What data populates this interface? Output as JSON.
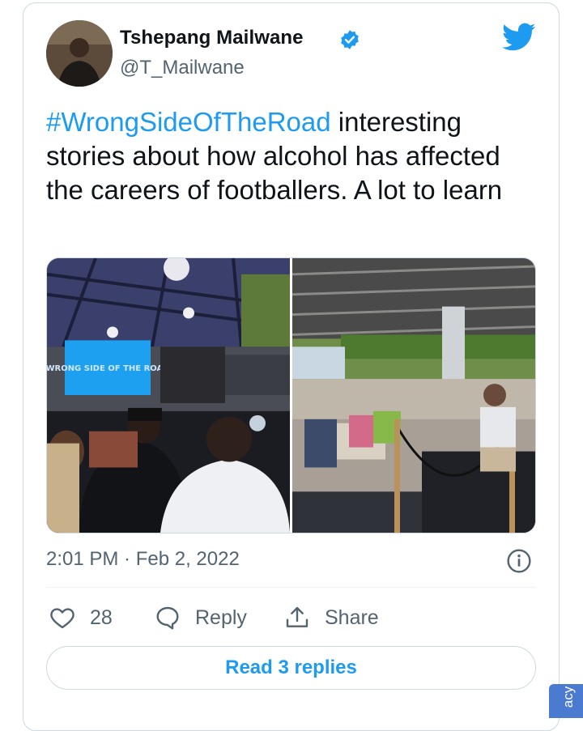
{
  "author": {
    "name": "Tshepang Mailwane",
    "handle": "@T_Mailwane",
    "verified": true,
    "avatar_icon": "profile-photo"
  },
  "brand_icon": "twitter-bird-icon",
  "tweet": {
    "hashtag": "#WrongSideOfTheRoad",
    "text": " interesting stories about how alcohol has affected the careers of footballers. A lot to learn"
  },
  "media": {
    "photo_count": 2,
    "left_photo_screen_text": "WRONG SIDE OF THE ROAD"
  },
  "meta": {
    "timestamp": "2:01 PM · Feb 2, 2022",
    "info_icon": "info-icon"
  },
  "actions": {
    "like_count": "28",
    "reply_label": "Reply",
    "share_label": "Share"
  },
  "read_replies_label": "Read 3 replies",
  "privacy_tab_label": "acy",
  "colors": {
    "accent": "#1d9bf0",
    "secondary_text": "#536471",
    "border": "#cfd9de"
  }
}
